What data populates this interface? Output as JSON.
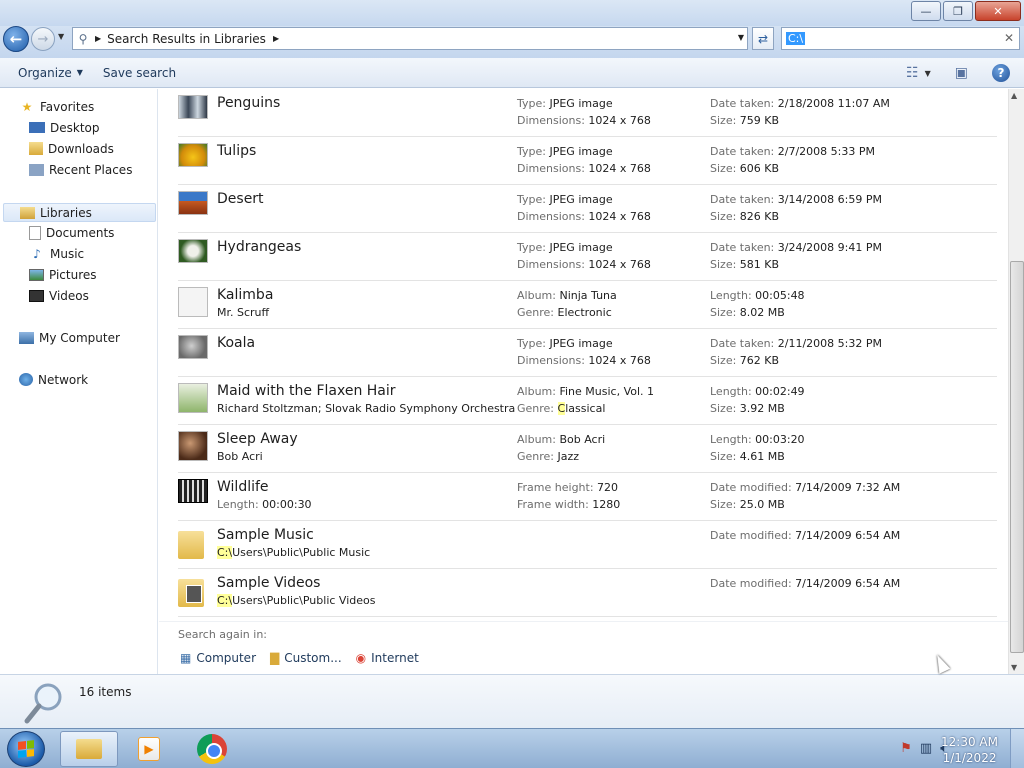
{
  "window": {
    "minimize_label": "—",
    "maximize_label": "❐",
    "close_label": "✕"
  },
  "address": {
    "path": "Search Results in Libraries",
    "search_value": "C:\\"
  },
  "toolbar": {
    "organize": "Organize",
    "save_search": "Save search"
  },
  "nav": {
    "favorites": "Favorites",
    "desktop": "Desktop",
    "downloads": "Downloads",
    "recent_places": "Recent Places",
    "libraries": "Libraries",
    "documents": "Documents",
    "music": "Music",
    "pictures": "Pictures",
    "videos": "Videos",
    "my_computer": "My Computer",
    "network": "Network"
  },
  "results": [
    {
      "name": "Penguins",
      "sub": "",
      "a_lbl": "Type:",
      "a_val": "JPEG image",
      "b_lbl": "Dimensions:",
      "b_val": "1024 x 768",
      "c_lbl": "Date taken:",
      "c_val": "2/18/2008 11:07 AM",
      "d_lbl": "Size:",
      "d_val": "759 KB"
    },
    {
      "name": "Tulips",
      "sub": "",
      "a_lbl": "Type:",
      "a_val": "JPEG image",
      "b_lbl": "Dimensions:",
      "b_val": "1024 x 768",
      "c_lbl": "Date taken:",
      "c_val": "2/7/2008 5:33 PM",
      "d_lbl": "Size:",
      "d_val": "606 KB"
    },
    {
      "name": "Desert",
      "sub": "",
      "a_lbl": "Type:",
      "a_val": "JPEG image",
      "b_lbl": "Dimensions:",
      "b_val": "1024 x 768",
      "c_lbl": "Date taken:",
      "c_val": "3/14/2008 6:59 PM",
      "d_lbl": "Size:",
      "d_val": "826 KB"
    },
    {
      "name": "Hydrangeas",
      "sub": "",
      "a_lbl": "Type:",
      "a_val": "JPEG image",
      "b_lbl": "Dimensions:",
      "b_val": "1024 x 768",
      "c_lbl": "Date taken:",
      "c_val": "3/24/2008 9:41 PM",
      "d_lbl": "Size:",
      "d_val": "581 KB"
    },
    {
      "name": "Kalimba",
      "sub": "Mr. Scruff",
      "a_lbl": "Album:",
      "a_val": "Ninja Tuna",
      "b_lbl": "Genre:",
      "b_val": "Electronic",
      "c_lbl": "Length:",
      "c_val": "00:05:48",
      "d_lbl": "Size:",
      "d_val": "8.02 MB"
    },
    {
      "name": "Koala",
      "sub": "",
      "a_lbl": "Type:",
      "a_val": "JPEG image",
      "b_lbl": "Dimensions:",
      "b_val": "1024 x 768",
      "c_lbl": "Date taken:",
      "c_val": "2/11/2008 5:32 PM",
      "d_lbl": "Size:",
      "d_val": "762 KB"
    },
    {
      "name": "Maid with the Flaxen Hair",
      "sub": "Richard Stoltzman; Slovak Radio Symphony Orchestra",
      "a_lbl": "Album:",
      "a_val": "Fine Music, Vol. 1",
      "b_lbl": "Genre:",
      "b_val_hl": "C",
      "b_val": "lassical",
      "c_lbl": "Length:",
      "c_val": "00:02:49",
      "d_lbl": "Size:",
      "d_val": "3.92 MB"
    },
    {
      "name": "Sleep Away",
      "sub": "Bob Acri",
      "a_lbl": "Album:",
      "a_val": "Bob Acri",
      "b_lbl": "Genre:",
      "b_val": "Jazz",
      "c_lbl": "Length:",
      "c_val": "00:03:20",
      "d_lbl": "Size:",
      "d_val": "4.61 MB"
    },
    {
      "name": "Wildlife",
      "sub_lbl": "Length:",
      "sub": "00:00:30",
      "a_lbl": "Frame height:",
      "a_val": "720",
      "b_lbl": "Frame width:",
      "b_val": "1280",
      "c_lbl": "Date modified:",
      "c_val": "7/14/2009 7:32 AM",
      "d_lbl": "Size:",
      "d_val": "25.0 MB"
    },
    {
      "name": "Sample Music",
      "sub_hl": "C:\\",
      "sub": "Users\\Public\\Public Music",
      "c_lbl": "Date modified:",
      "c_val": "7/14/2009 6:54 AM"
    },
    {
      "name": "Sample Videos",
      "sub_hl": "C:\\",
      "sub": "Users\\Public\\Public Videos",
      "c_lbl": "Date modified:",
      "c_val": "7/14/2009 6:54 AM"
    }
  ],
  "search_again": {
    "label": "Search again in:",
    "computer": "Computer",
    "custom": "Custom...",
    "internet": "Internet"
  },
  "status": {
    "count": "16 items"
  },
  "taskbar": {
    "time": "12:30 AM",
    "date": "1/1/2022"
  }
}
